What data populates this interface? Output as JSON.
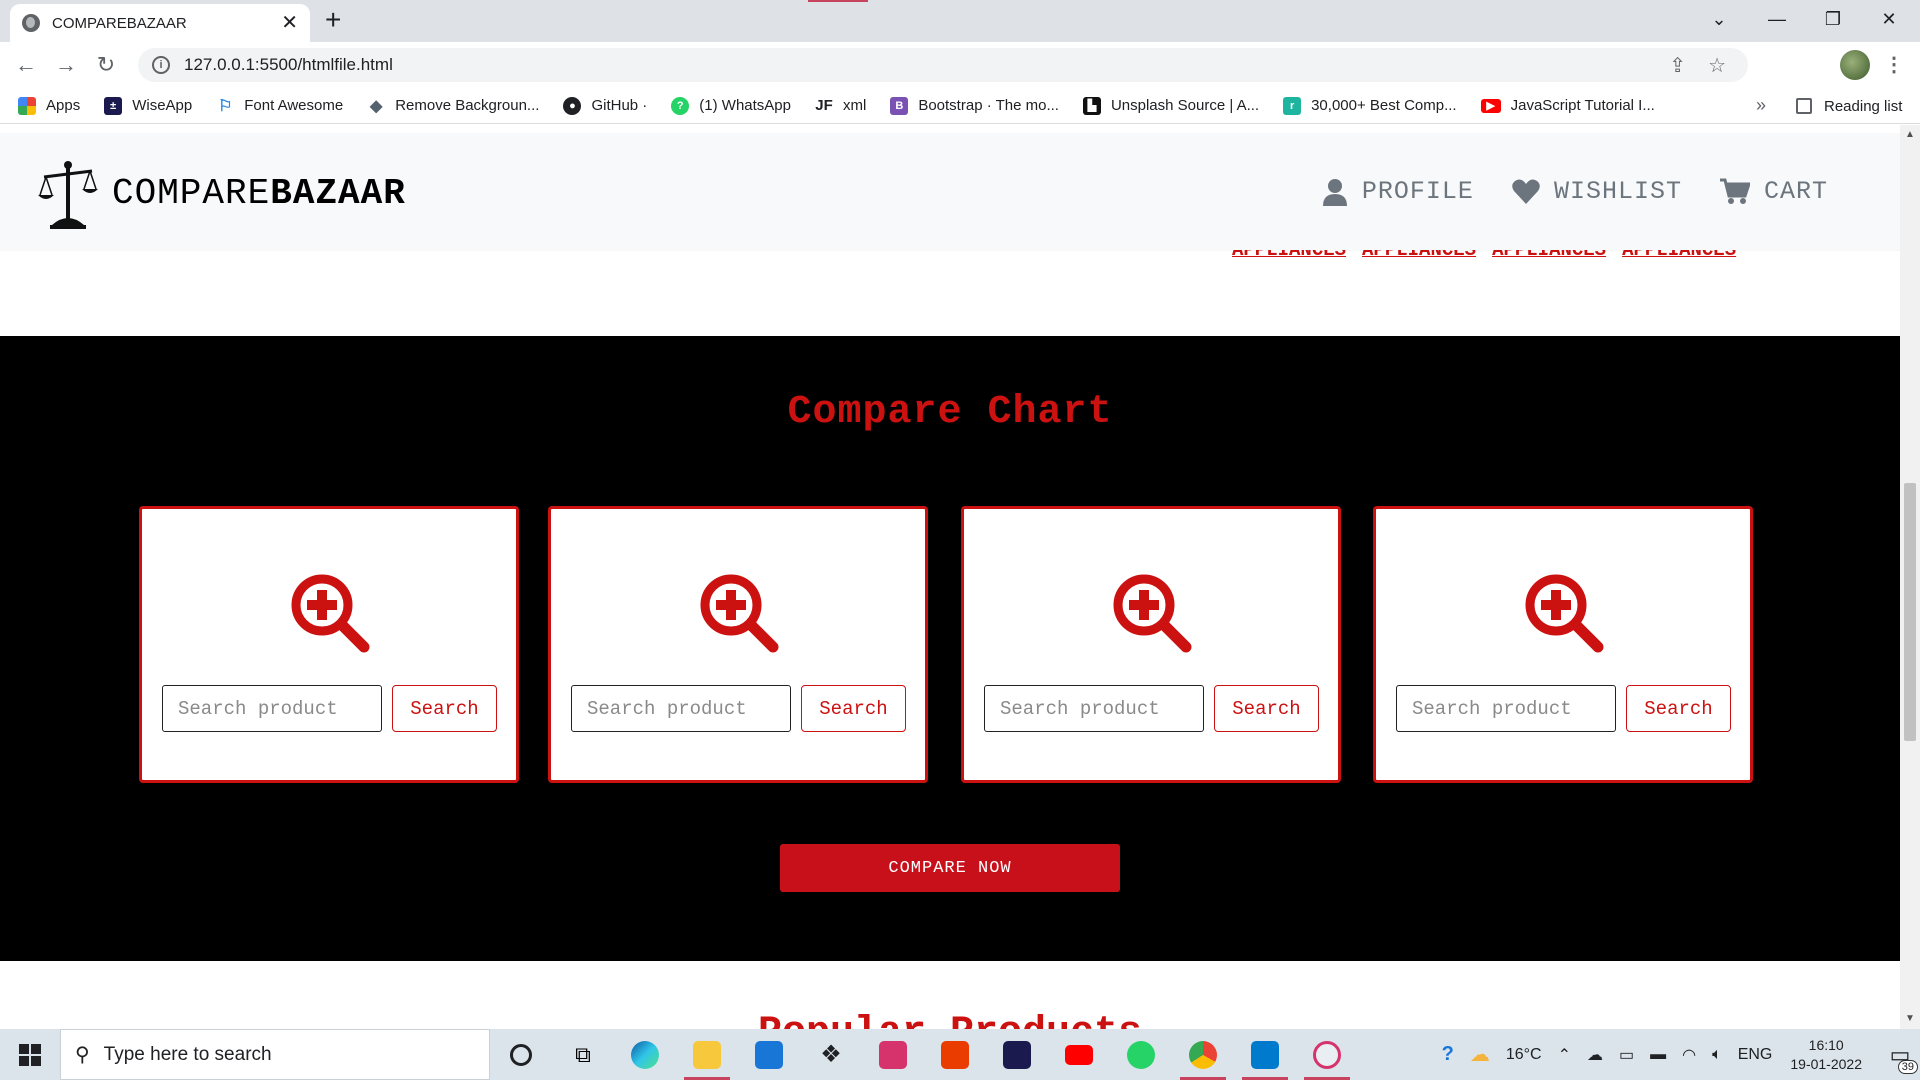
{
  "browser": {
    "tab_title": "COMPAREBAZAAR",
    "url": "127.0.0.1:5500/htmlfile.html",
    "bookmarks": [
      {
        "label": "Apps",
        "icon": "apps-grid-icon",
        "color": "#4285f4"
      },
      {
        "label": "WiseApp",
        "icon": "wiseapp-icon",
        "color": "#1a1a4e"
      },
      {
        "label": "Font Awesome",
        "icon": "flag-icon",
        "color": "#228ae6"
      },
      {
        "label": "Remove Backgroun...",
        "icon": "remove-bg-icon",
        "color": "#54616e"
      },
      {
        "label": "GitHub ·",
        "icon": "github-icon",
        "color": "#202124"
      },
      {
        "label": "(1) WhatsApp",
        "icon": "whatsapp-icon",
        "color": "#25d366"
      },
      {
        "label": "xml",
        "icon": "jf-icon",
        "color": "#202124"
      },
      {
        "label": "Bootstrap · The mo...",
        "icon": "bootstrap-icon",
        "color": "#7952b3"
      },
      {
        "label": "Unsplash Source | A...",
        "icon": "unsplash-icon",
        "color": "#111111"
      },
      {
        "label": "30,000+ Best Comp...",
        "icon": "compare-site-icon",
        "color": "#1db5a0"
      },
      {
        "label": "JavaScript Tutorial I...",
        "icon": "youtube-icon",
        "color": "#ff0000"
      }
    ],
    "reading_list": "Reading list"
  },
  "site": {
    "brand_light": "COMPARE",
    "brand_bold": "BAZAAR",
    "nav": {
      "profile": "PROFILE",
      "wishlist": "WISHLIST",
      "cart": "CART"
    },
    "appliances": [
      "APPLIANCES",
      "APPLIANCES",
      "APPLIANCES",
      "APPLIANCES"
    ],
    "compare_title": "Compare Chart",
    "cards": [
      {
        "placeholder": "Search product",
        "button": "Search"
      },
      {
        "placeholder": "Search product",
        "button": "Search"
      },
      {
        "placeholder": "Search product",
        "button": "Search"
      },
      {
        "placeholder": "Search product",
        "button": "Search"
      }
    ],
    "compare_button": "COMPARE NOW",
    "popular_title": "Popular Products",
    "accent_color": "#cc1111"
  },
  "taskbar": {
    "search_placeholder": "Type here to search",
    "temperature": "16°C",
    "language": "ENG",
    "time": "16:10",
    "date": "19-01-2022",
    "notifications": "39"
  }
}
